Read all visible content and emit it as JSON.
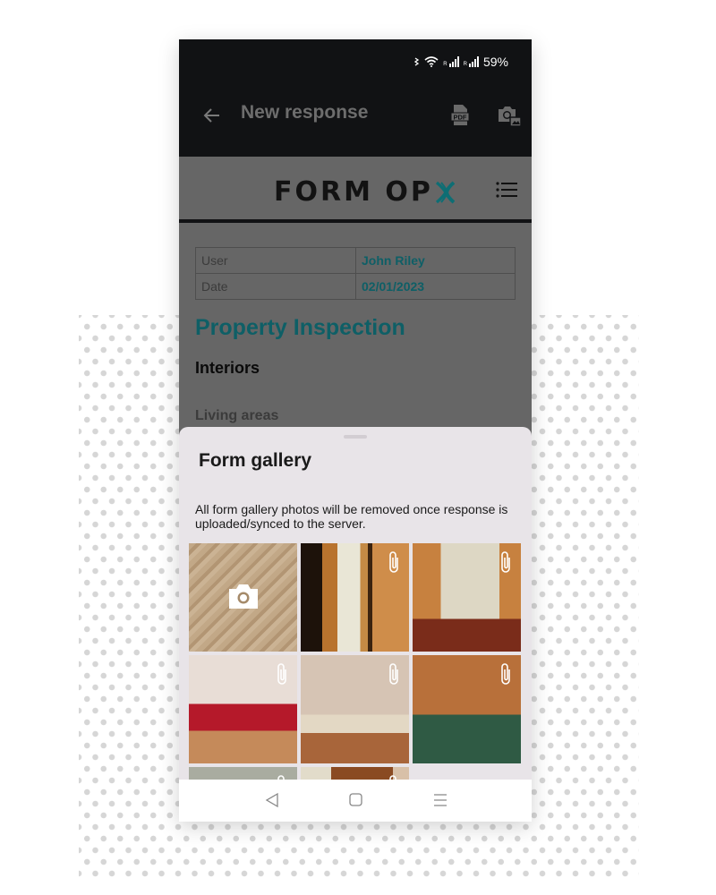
{
  "status_bar": {
    "battery": "59%",
    "icons": [
      "bluetooth-icon",
      "wifi-icon",
      "signal-icon",
      "signal-icon",
      "battery-text"
    ]
  },
  "app_bar": {
    "back_icon": "arrow-left-icon",
    "title": "New response",
    "actions": [
      {
        "name": "export-pdf-button",
        "icon": "pdf-icon"
      },
      {
        "name": "form-gallery-button",
        "icon": "camera-gallery-icon"
      }
    ]
  },
  "header": {
    "logo_text": "FORM OP",
    "logo_accent_color": "#0e6e74",
    "menu_icon": "list-menu-icon"
  },
  "form": {
    "info_rows": [
      {
        "label": "User",
        "value": "John Riley"
      },
      {
        "label": "Date",
        "value": "02/01/2023"
      }
    ],
    "title": "Property Inspection",
    "section": "Interiors",
    "subsection": "Living areas",
    "accent_color": "#0e5f66"
  },
  "gallery_sheet": {
    "title": "Form gallery",
    "note": "All form gallery photos will be removed once response is uploaded/synced to the server.",
    "tiles": [
      {
        "kind": "capture",
        "subject": "wood floor",
        "icon": "camera-icon",
        "bg": "#b89d7c"
      },
      {
        "kind": "photo",
        "subject": "door and light switch",
        "icon": "paperclip-icon",
        "bg": "#8a5a30"
      },
      {
        "kind": "photo",
        "subject": "bathroom shower",
        "icon": "paperclip-icon",
        "bg": "#9a6a3c"
      },
      {
        "kind": "photo",
        "subject": "bedroom red bedspread",
        "icon": "paperclip-icon",
        "bg": "#a87a56"
      },
      {
        "kind": "photo",
        "subject": "bedroom with window",
        "icon": "paperclip-icon",
        "bg": "#9c6c48"
      },
      {
        "kind": "photo",
        "subject": "kitchen hob",
        "icon": "paperclip-icon",
        "bg": "#a0653a"
      },
      {
        "kind": "photo",
        "subject": "bedroom",
        "icon": "paperclip-icon",
        "bg": "#a9aca0"
      },
      {
        "kind": "photo",
        "subject": "wardrobe",
        "icon": "paperclip-icon",
        "bg": "#8a4a22"
      }
    ]
  },
  "nav_bar": {
    "buttons": [
      {
        "name": "nav-back-button",
        "icon": "triangle-back-icon"
      },
      {
        "name": "nav-home-button",
        "icon": "square-home-icon"
      },
      {
        "name": "nav-recents-button",
        "icon": "lines-recents-icon"
      }
    ]
  }
}
